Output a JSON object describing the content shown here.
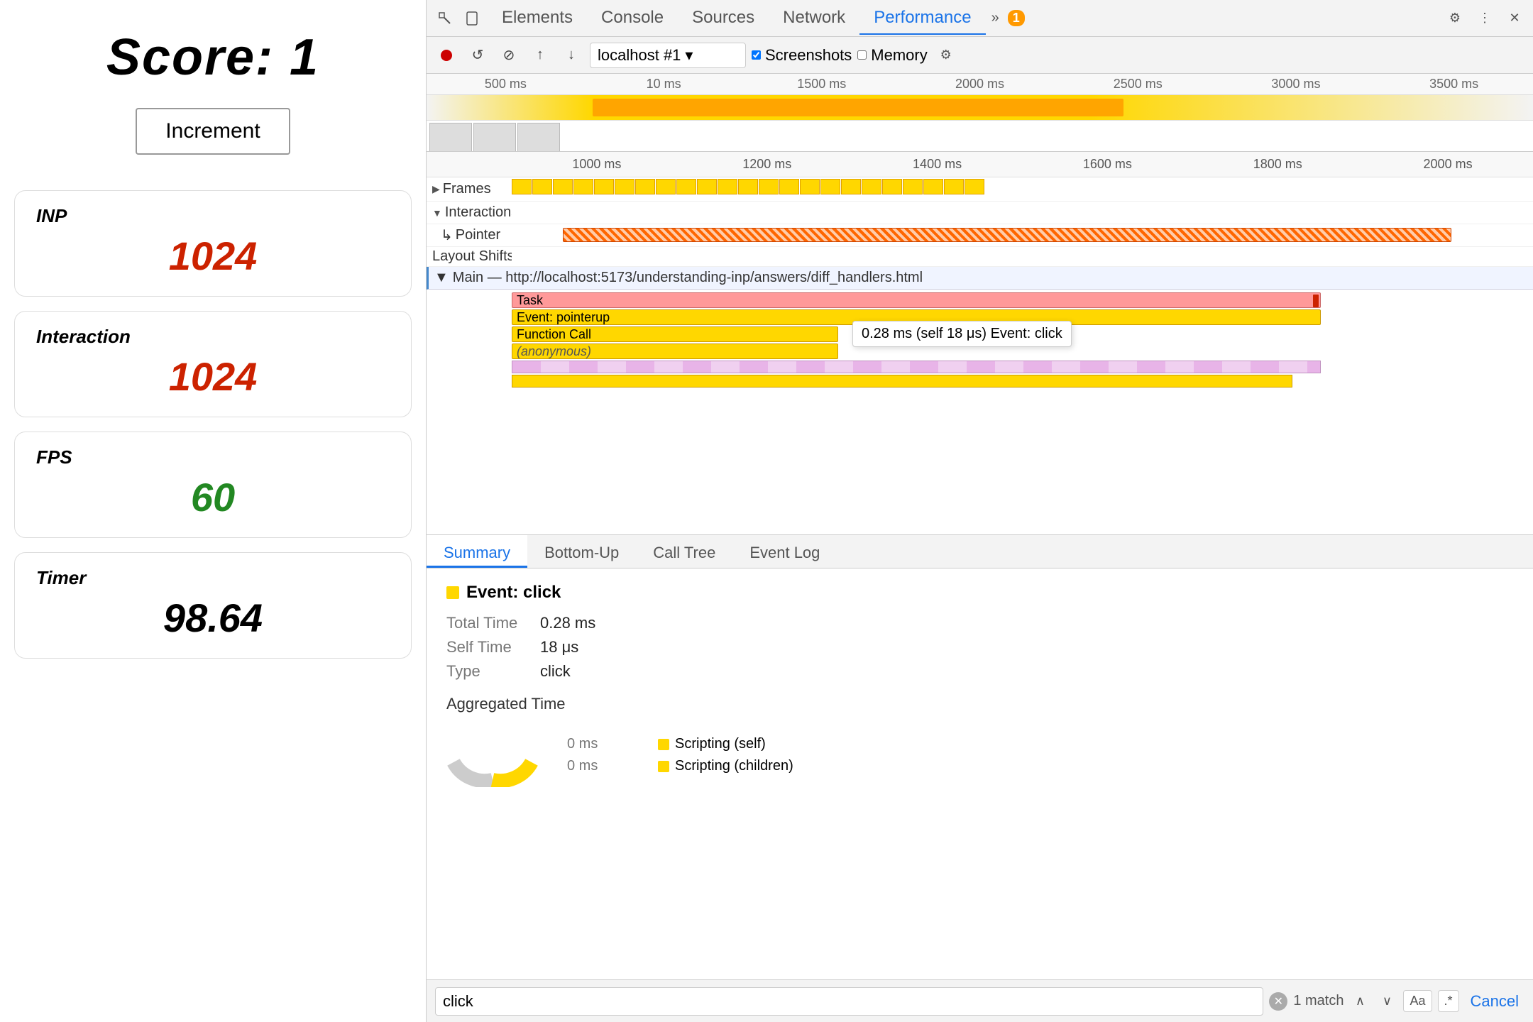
{
  "left": {
    "score_label": "Score: 1",
    "increment_btn": "Increment",
    "metrics": [
      {
        "id": "inp",
        "label": "INP",
        "value": "1024",
        "color": "red"
      },
      {
        "id": "interaction",
        "label": "Interaction",
        "value": "1024",
        "color": "red"
      },
      {
        "id": "fps",
        "label": "FPS",
        "value": "60",
        "color": "green"
      },
      {
        "id": "timer",
        "label": "Timer",
        "value": "98.64",
        "color": "black"
      }
    ]
  },
  "devtools": {
    "tabs": [
      "Elements",
      "Console",
      "Sources",
      "Network",
      "Performance",
      "»"
    ],
    "active_tab": "Performance",
    "warning_count": "1",
    "perf_controls": {
      "url": "localhost #1",
      "screenshots_label": "Screenshots",
      "memory_label": "Memory"
    },
    "timeline": {
      "overview_ruler": [
        "500 ms",
        "10 ms",
        "1500 ms",
        "2000 ms",
        "2500 ms",
        "3000 ms",
        "3500 ms"
      ],
      "detail_ruler": [
        "1000 ms",
        "1200 ms",
        "1400 ms",
        "1600 ms",
        "1800 ms",
        "2000 ms"
      ],
      "rows": [
        {
          "id": "frames",
          "label": "▶ Frames",
          "has_arrow": true
        },
        {
          "id": "interactions",
          "label": "▼ Interactions"
        },
        {
          "id": "pointer",
          "label": "↳ Pointer"
        },
        {
          "id": "layout-shifts",
          "label": "Layout Shifts"
        },
        {
          "id": "main",
          "label": "▼ Main — http://localhost:5173/understanding-inp/answers/diff_handlers.html"
        }
      ],
      "task_bars": [
        {
          "id": "task",
          "label": "Task",
          "color": "task-main"
        },
        {
          "id": "event-pointerup",
          "label": "Event: pointerup",
          "color": "task-pointerup"
        },
        {
          "id": "function-call",
          "label": "Function Call",
          "color": "task-function"
        },
        {
          "id": "anonymous",
          "label": "(anonymous)",
          "color": "task-anon"
        }
      ],
      "tooltip": {
        "text": "0.28 ms (self 18 μs)",
        "label": "Event: click"
      }
    },
    "bottom_tabs": [
      "Summary",
      "Bottom-Up",
      "Call Tree",
      "Event Log"
    ],
    "active_bottom_tab": "Summary",
    "summary": {
      "event_title": "Event: click",
      "total_time_label": "Total Time",
      "total_time_value": "0.28 ms",
      "self_time_label": "Self Time",
      "self_time_value": "18 μs",
      "type_label": "Type",
      "type_value": "click",
      "aggregated_title": "Aggregated Time",
      "legend": [
        {
          "label": "0 ms",
          "desc": "Scripting (self)",
          "color": "#ffd700"
        },
        {
          "label": "0 ms",
          "desc": "Scripting (children)",
          "color": "#ffd700"
        }
      ]
    },
    "search": {
      "placeholder": "click",
      "match_text": "1 match",
      "cancel_label": "Cancel"
    }
  }
}
